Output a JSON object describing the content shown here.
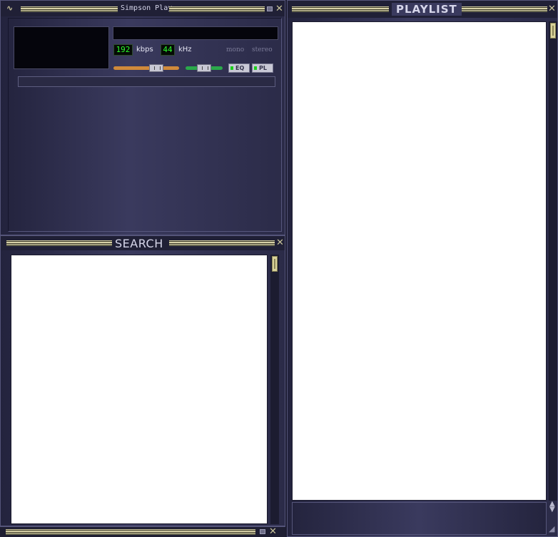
{
  "player": {
    "title": "Simpson Play",
    "bitrate": "192",
    "bitrate_unit": "kbps",
    "samplerate": "44",
    "samplerate_unit": "kHz",
    "mono_label": "mono",
    "stereo_label": "stereo",
    "eq_label": "EQ",
    "pl_label": "PL",
    "volume": 0.7,
    "balance": 0.5
  },
  "search": {
    "title": "SEARCH"
  },
  "playlist": {
    "title": "PLAYLIST"
  },
  "colors": {
    "accent": "#d8d2a8",
    "lcd": "#2bff2b",
    "volume_track": "#d08a3a",
    "balance_track": "#2aa84a"
  }
}
